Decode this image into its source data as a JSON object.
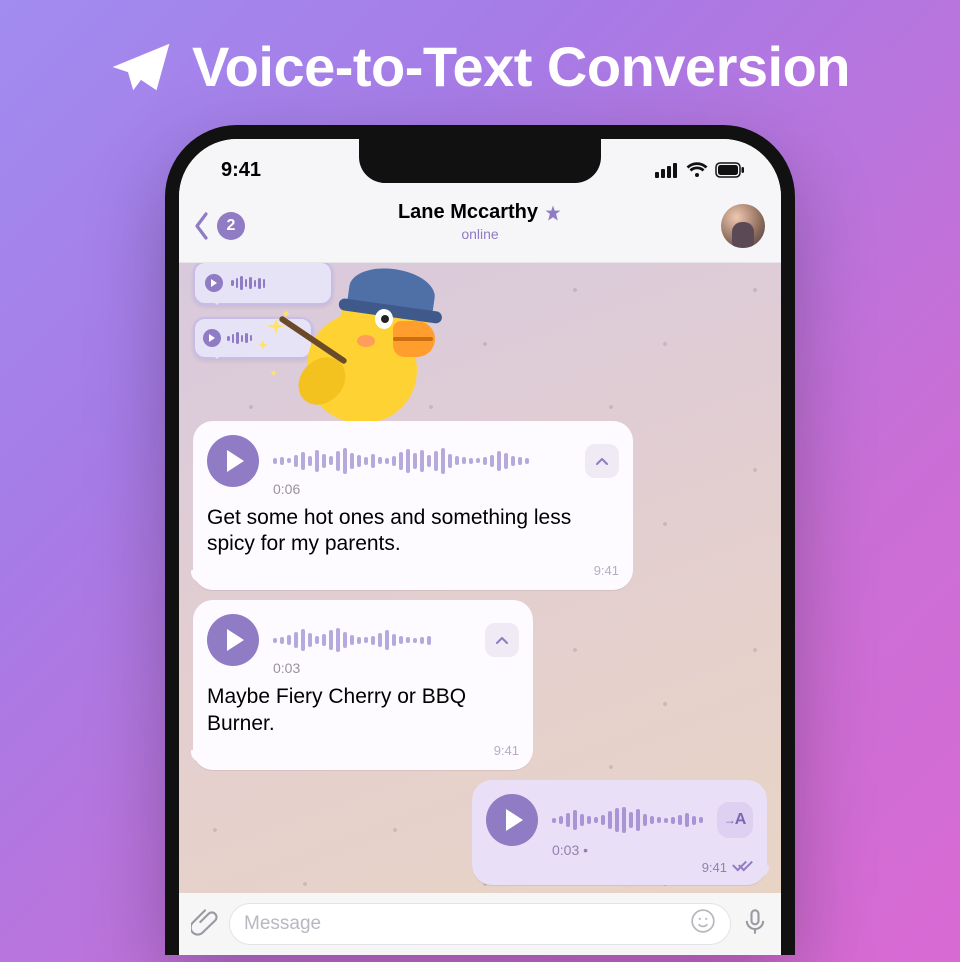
{
  "headline": {
    "text": "Voice-to-Text Conversion"
  },
  "statusbar": {
    "time": "9:41"
  },
  "navbar": {
    "unread_count": "2",
    "title": "Lane Mccarthy",
    "status": "online"
  },
  "messages": [
    {
      "kind": "voice_in",
      "duration": "0:06",
      "transcript": "Get some hot ones and something less spicy for my parents.",
      "time": "9:41"
    },
    {
      "kind": "voice_in",
      "duration": "0:03",
      "transcript": "Maybe Fiery Cherry or BBQ Burner.",
      "time": "9:41"
    },
    {
      "kind": "voice_out",
      "duration": "0:03",
      "to_text_label": "A",
      "time": "9:41"
    }
  ],
  "input": {
    "placeholder": "Message"
  },
  "colors": {
    "accent": "#8f7cc4",
    "bubble_in": "#fdfbff",
    "bubble_out": "#e9dff7"
  }
}
